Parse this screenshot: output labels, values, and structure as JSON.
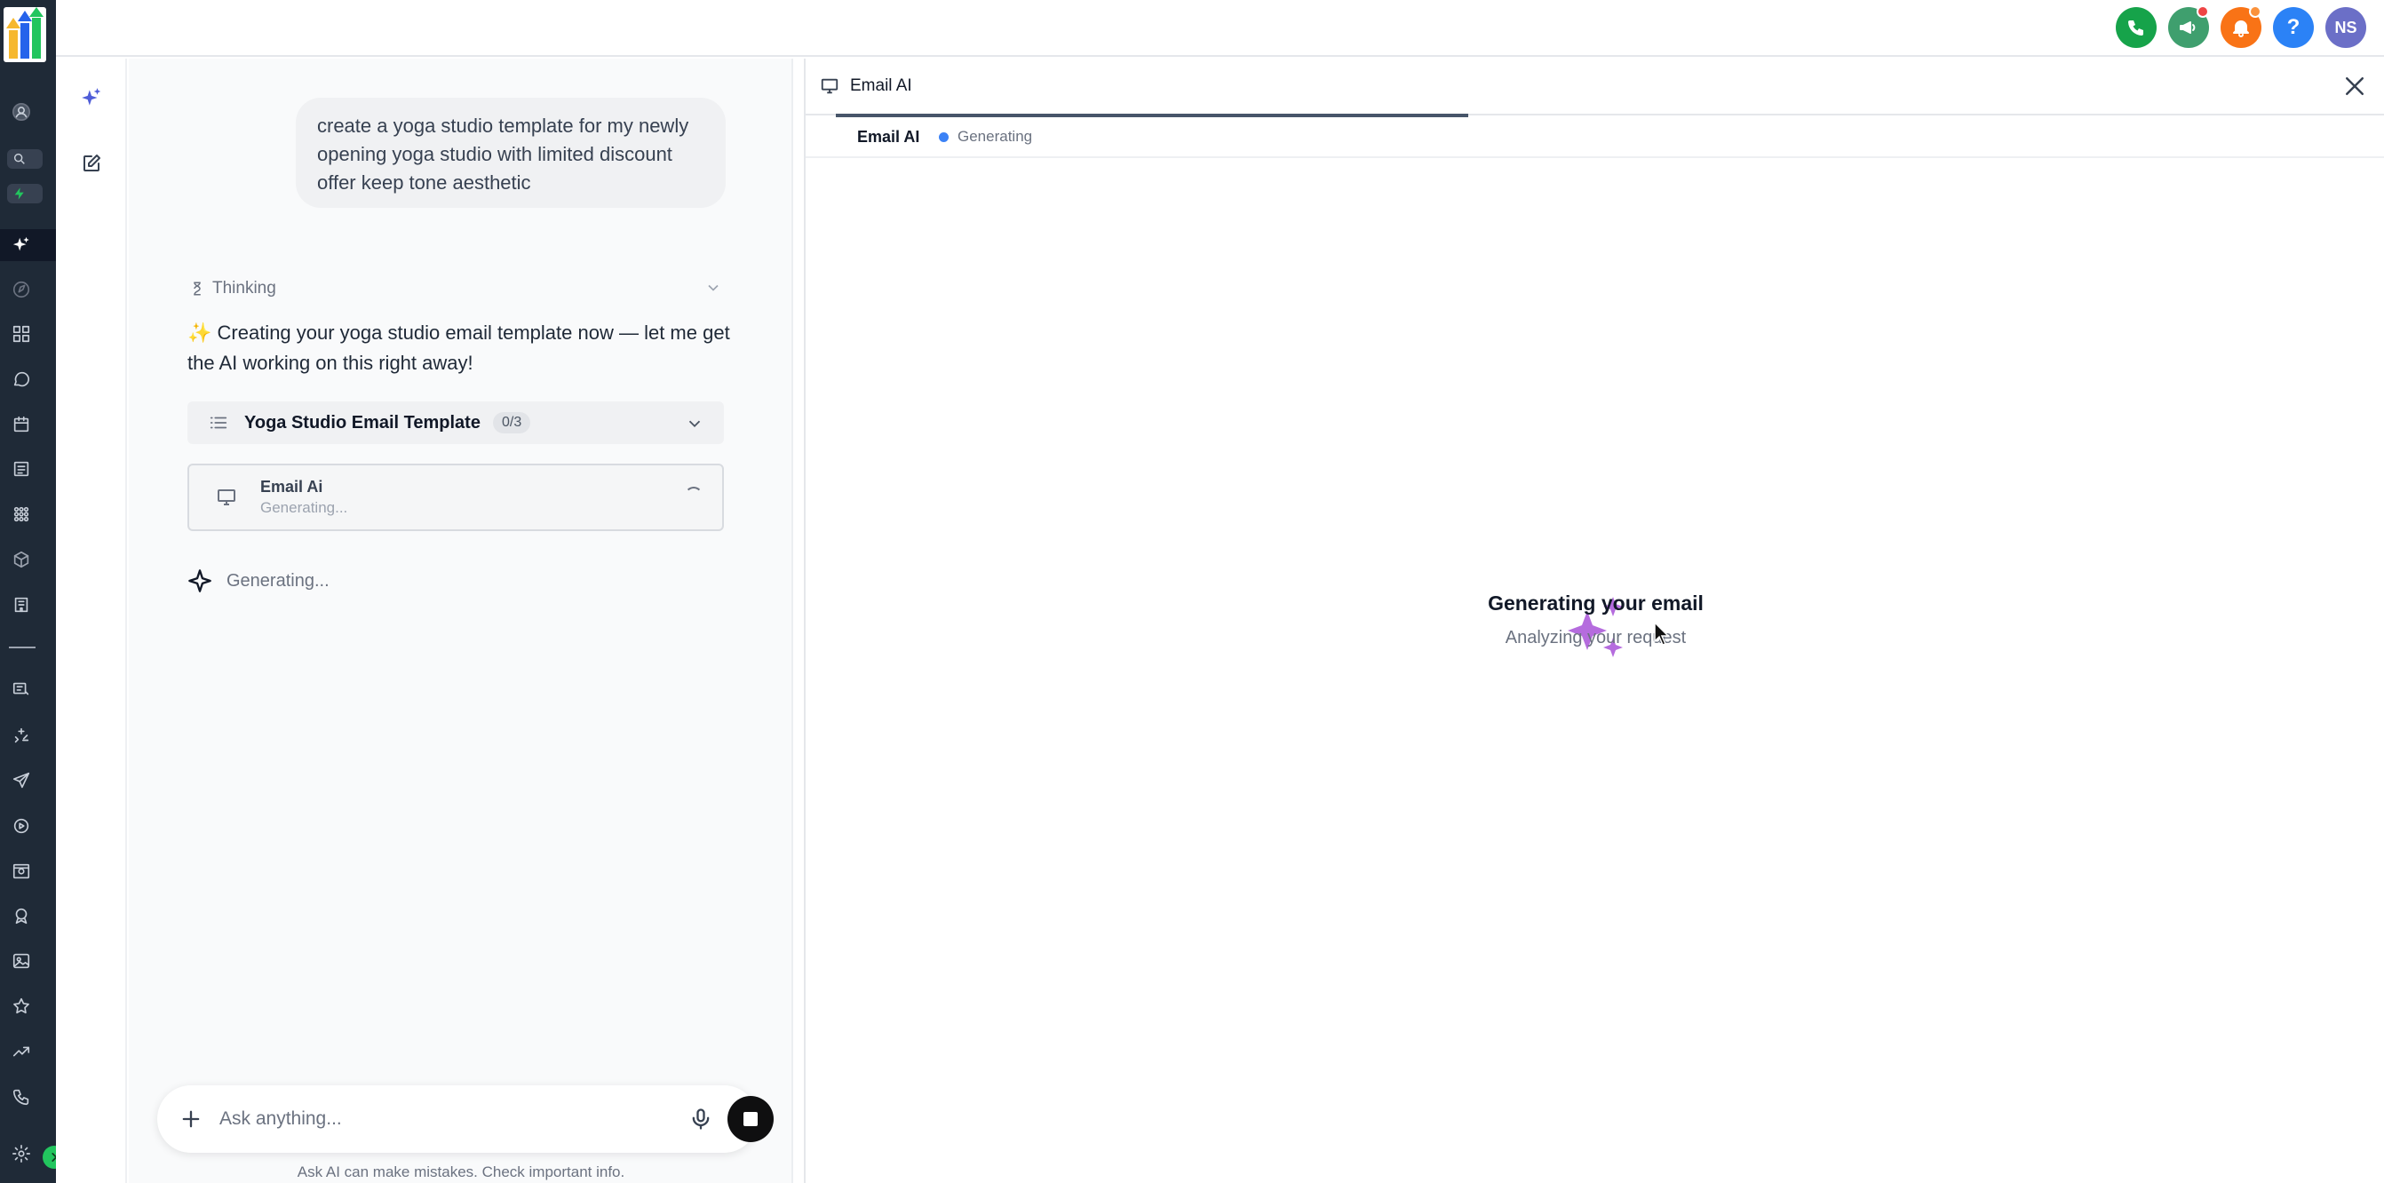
{
  "topbar": {
    "buttons": [
      {
        "name": "phone-icon",
        "color": "#16a34a"
      },
      {
        "name": "megaphone-icon",
        "color": "#3f9f6e"
      },
      {
        "name": "bell-icon",
        "color": "#f97316"
      },
      {
        "name": "help-icon",
        "color": "#2b82f6",
        "label": "?"
      },
      {
        "name": "avatar",
        "color": "#6b6fc7",
        "label": "NS"
      }
    ]
  },
  "rail": {
    "avatar_initials": "NS",
    "icons": [
      "contacts-icon",
      "search-icon",
      "flash-icon",
      "ai-sparkle-icon",
      "launchpad-icon",
      "dashboard-icon",
      "conversations-icon",
      "calendar-icon",
      "contacts-card-icon",
      "opportunities-icon",
      "payments-icon",
      "sites-icon",
      "marketing-icon",
      "automation-icon",
      "send-icon",
      "reputation-icon",
      "reporting-icon",
      "memberships-icon",
      "media-icon",
      "star-icon",
      "trend-icon",
      "phone-settings-icon",
      "settings-icon"
    ]
  },
  "chat": {
    "user_message": "create a yoga studio template for my newly opening yoga studio with limited discount offer keep tone aesthetic",
    "thinking_label": "Thinking",
    "assistant_message": "✨ Creating your yoga studio email template now — let me get the AI working on this right away!",
    "task_group": {
      "title": "Yoga Studio Email Template",
      "count": "0/3"
    },
    "task_item": {
      "name": "Email Ai",
      "status": "Generating..."
    },
    "generating_label": "Generating...",
    "composer_placeholder": "Ask anything...",
    "disclaimer": "Ask AI can make mistakes. Check important info."
  },
  "preview": {
    "header_title": "Email AI",
    "tab_label": "Email AI",
    "tab_status": "Generating",
    "center_heading": "Generating your email",
    "center_sub": "Analyzing your request",
    "accent_color": "#b56cde"
  }
}
